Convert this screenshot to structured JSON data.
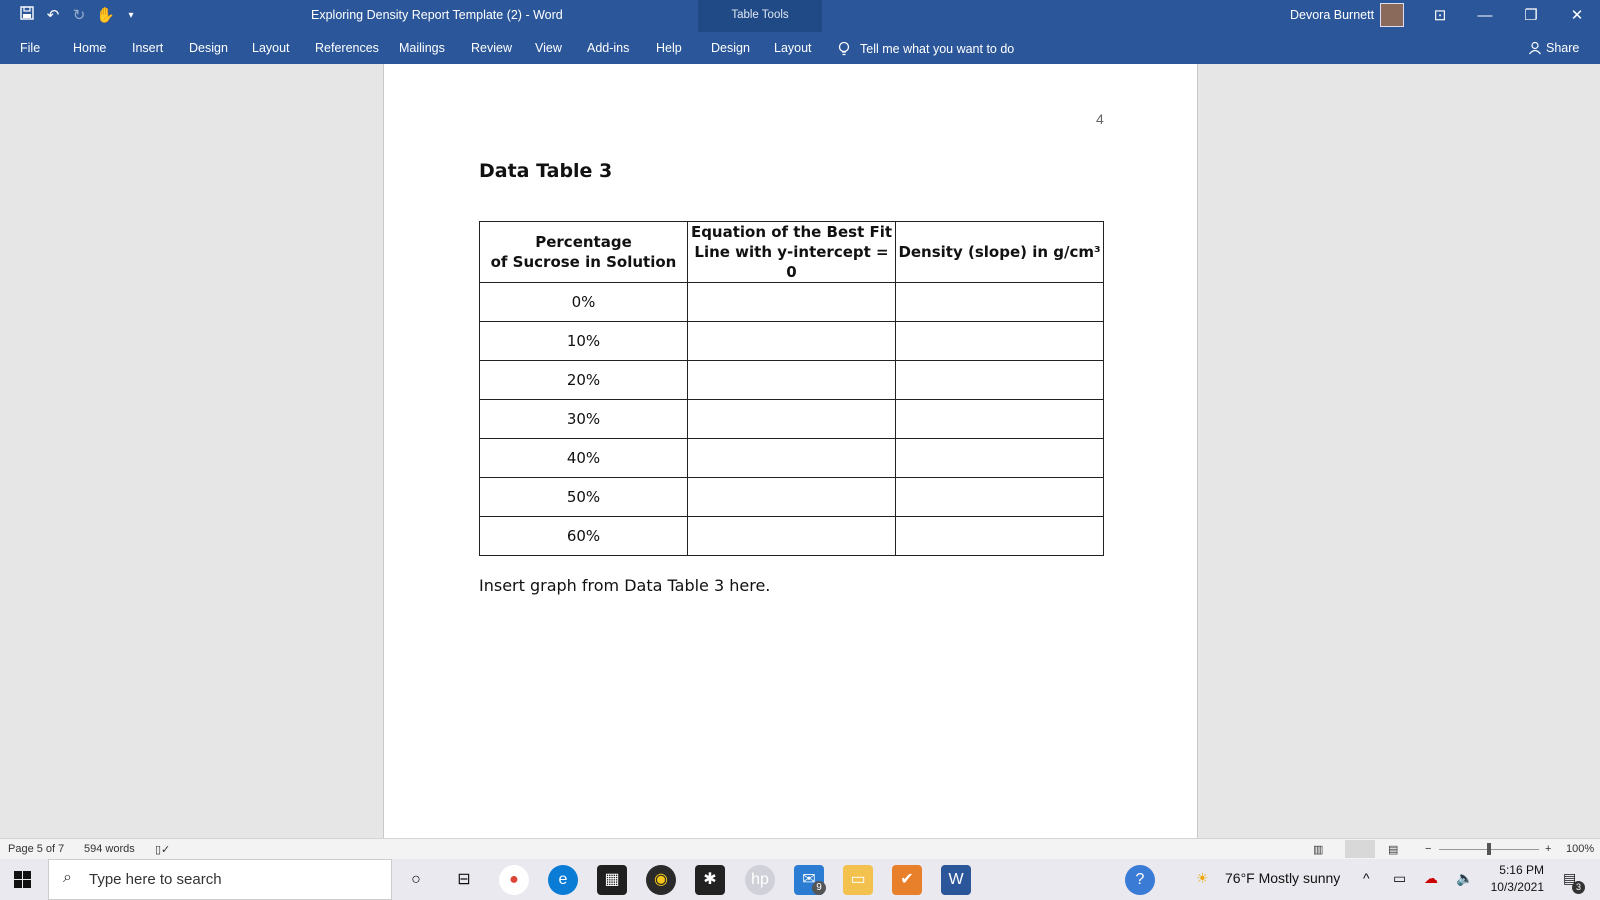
{
  "titlebar": {
    "document_title": "Exploring Density Report Template (2)  -  Word",
    "context_label": "Table Tools",
    "user_name": "Devora Burnett",
    "quick_access": [
      "save-icon",
      "undo-icon",
      "redo-icon",
      "touch-mode-icon",
      "customize-icon"
    ]
  },
  "ribbon": {
    "tabs": [
      "File",
      "Home",
      "Insert",
      "Design",
      "Layout",
      "References",
      "Mailings",
      "Review",
      "View",
      "Add-ins",
      "Help",
      "Design",
      "Layout"
    ],
    "tell_me": "Tell me what you want to do",
    "share": "Share"
  },
  "document": {
    "page_number": "4",
    "heading": "Data Table 3",
    "table": {
      "headers": [
        [
          "Percentage",
          "of Sucrose in Solution"
        ],
        [
          "Equation of the Best Fit",
          "Line with y-intercept = 0"
        ],
        [
          "Density (slope) in g/cm³"
        ]
      ],
      "rows": [
        [
          "0%",
          "",
          ""
        ],
        [
          "10%",
          "",
          ""
        ],
        [
          "20%",
          "",
          ""
        ],
        [
          "30%",
          "",
          ""
        ],
        [
          "40%",
          "",
          ""
        ],
        [
          "50%",
          "",
          ""
        ],
        [
          "60%",
          "",
          ""
        ]
      ]
    },
    "note": "Insert graph from Data Table 3 here."
  },
  "statusbar": {
    "page": "Page 5 of 7",
    "words": "594 words",
    "zoom": "100%",
    "zoom_level": 1.0
  },
  "taskbar": {
    "search_placeholder": "Type here to search",
    "mail_badge": "9",
    "weather": "76°F  Mostly sunny",
    "time": "5:16 PM",
    "date": "10/3/2021",
    "notification_count": "3"
  },
  "colors": {
    "word_blue": "#2b579a",
    "context_tab": "#204a86"
  }
}
